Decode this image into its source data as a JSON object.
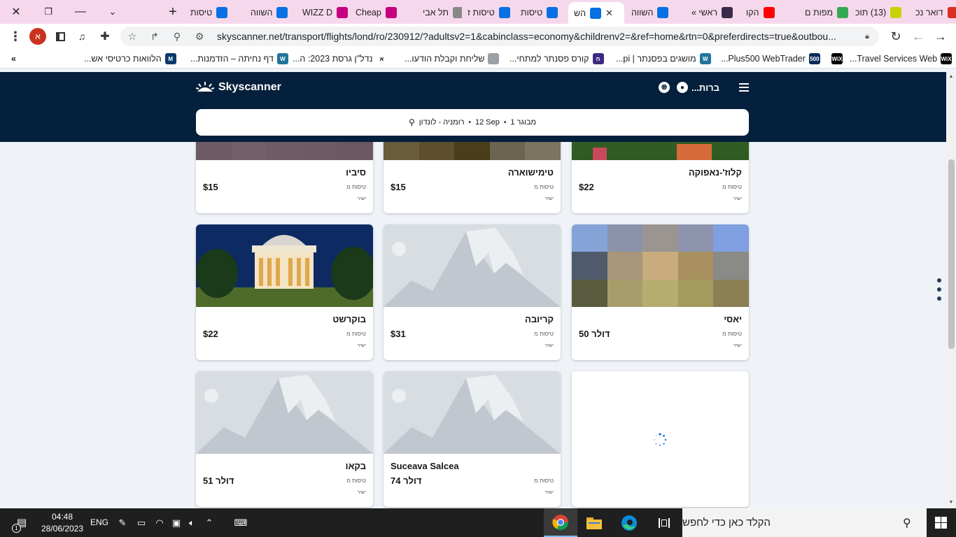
{
  "browser": {
    "tabs": [
      {
        "label": "דואר נכ",
        "icon": "gmail-icon",
        "color": "#d93025",
        "active": false
      },
      {
        "label": "(13) תוכ",
        "icon": "chat-icon",
        "color": "#c7d300",
        "active": false
      },
      {
        "label": "מפות ם",
        "icon": "maps-icon",
        "color": "#34a853",
        "active": false
      },
      {
        "label": "הקו",
        "icon": "youtube-icon",
        "color": "#ff0000",
        "active": false
      },
      {
        "label": "ראשי »",
        "icon": "site-icon",
        "color": "#3a2a4a",
        "active": false
      },
      {
        "label": "השווה",
        "icon": "skyscanner-icon",
        "color": "#0770e3",
        "active": false
      },
      {
        "label": "הש",
        "icon": "skyscanner-icon",
        "color": "#0770e3",
        "active": true
      },
      {
        "label": "טיסות",
        "icon": "skyscanner-icon",
        "color": "#0770e3",
        "active": false
      },
      {
        "label": "טיסות ז",
        "icon": "skyscanner-icon",
        "color": "#0770e3",
        "active": false
      },
      {
        "label": "תל אבי",
        "icon": "globe-icon",
        "color": "#888888",
        "active": false
      },
      {
        "label": "Cheap",
        "icon": "wizz-icon",
        "color": "#c6007e",
        "active": false
      },
      {
        "label": "WIZZ D",
        "icon": "wizz-icon",
        "color": "#c6007e",
        "active": false
      },
      {
        "label": "השווה",
        "icon": "skyscanner-icon",
        "color": "#0770e3",
        "active": false
      },
      {
        "label": "טיסות",
        "icon": "skyscanner-icon",
        "color": "#0770e3",
        "active": false
      }
    ],
    "url": "skyscanner.net/transport/flights/lond/ro/230912/?adultsv2=1&cabinclass=economy&childrenv2=&ref=home&rtn=0&preferdirects=true&outbou...",
    "profile_initial": "א",
    "bookmarks": [
      {
        "label": "Travel Services Web...",
        "icon": "wix-icon",
        "color": "#000000",
        "badge": "WiX"
      },
      {
        "label": "",
        "icon": "wix-icon",
        "color": "#000000",
        "badge": "WiX"
      },
      {
        "label": "Plus500 WebTrader...",
        "icon": "plus500-icon",
        "color": "#0a2a5a",
        "badge": "500"
      },
      {
        "label": "מושגים בפסנתר | pi...",
        "icon": "wordpress-icon",
        "color": "#21759b",
        "badge": "W"
      },
      {
        "label": "קורס פסנתר למתחי...",
        "icon": "site-icon",
        "color": "#3c2a80",
        "badge": "ח"
      },
      {
        "label": "שליחת וקבלת הודעו...",
        "icon": "document-icon",
        "color": "#9aa0a6",
        "badge": ""
      },
      {
        "label": "נדל\"ן גרסת 2023: ה...",
        "icon": "aleph-icon",
        "color": "#ffffff",
        "badge": "א"
      },
      {
        "label": "דף נחיתה – הזדמנות...",
        "icon": "wordpress-icon",
        "color": "#21759b",
        "badge": "W"
      },
      {
        "label": "הלוואות כרטיסי אש...",
        "icon": "m-icon",
        "color": "#0a3a6a",
        "badge": "M"
      }
    ],
    "more_bookmarks": "»"
  },
  "header": {
    "brand": "Skyscanner",
    "account_label": "...ברות",
    "search": {
      "passengers": "מבוגר 1",
      "date": "12 Sep",
      "route": "רומניה - לונדון"
    }
  },
  "cards": [
    {
      "name": "קלוז'-נאפוקה",
      "price": "$22",
      "sub": "טיסות מ",
      "direct": "ישיר",
      "image": "photo-cluj",
      "name_ltr": false
    },
    {
      "name": "טימישוארה",
      "price": "$15",
      "sub": "טיסות מ",
      "direct": "ישיר",
      "image": "photo-timisoara",
      "name_ltr": false
    },
    {
      "name": "סיביו",
      "price": "$15",
      "sub": "טיסות מ",
      "direct": "ישיר",
      "image": "photo-sibiu",
      "name_ltr": false
    },
    {
      "name": "יאסי",
      "price": "דולר 50",
      "sub": "טיסות מ",
      "direct": "ישיר",
      "image": "photo-iasi",
      "name_ltr": false
    },
    {
      "name": "קריובה",
      "price": "$31",
      "sub": "טיסות מ",
      "direct": "ישיר",
      "image": "placeholder",
      "name_ltr": false
    },
    {
      "name": "בוקרשט",
      "price": "$22",
      "sub": "טיסות מ",
      "direct": "ישיר",
      "image": "photo-bucharest",
      "name_ltr": false
    },
    {
      "name": "Suceava Salcea",
      "price": "דולר 74",
      "sub": "טיסות מ",
      "direct": "ישיר",
      "image": "placeholder",
      "name_ltr": true
    },
    {
      "name": "בקאו",
      "price": "דולר 51",
      "sub": "טיסות מ",
      "direct": "ישיר",
      "image": "placeholder",
      "name_ltr": false
    }
  ],
  "taskbar": {
    "search_placeholder": "הקלד כאן כדי לחפש",
    "time": "04:48",
    "date": "28/06/2023",
    "language": "ENG",
    "notification_count": "1"
  },
  "colors": {
    "skyscanner_navy": "#05203c",
    "page_background": "#eff3f8",
    "tab_strip": "#f6d8ec"
  }
}
